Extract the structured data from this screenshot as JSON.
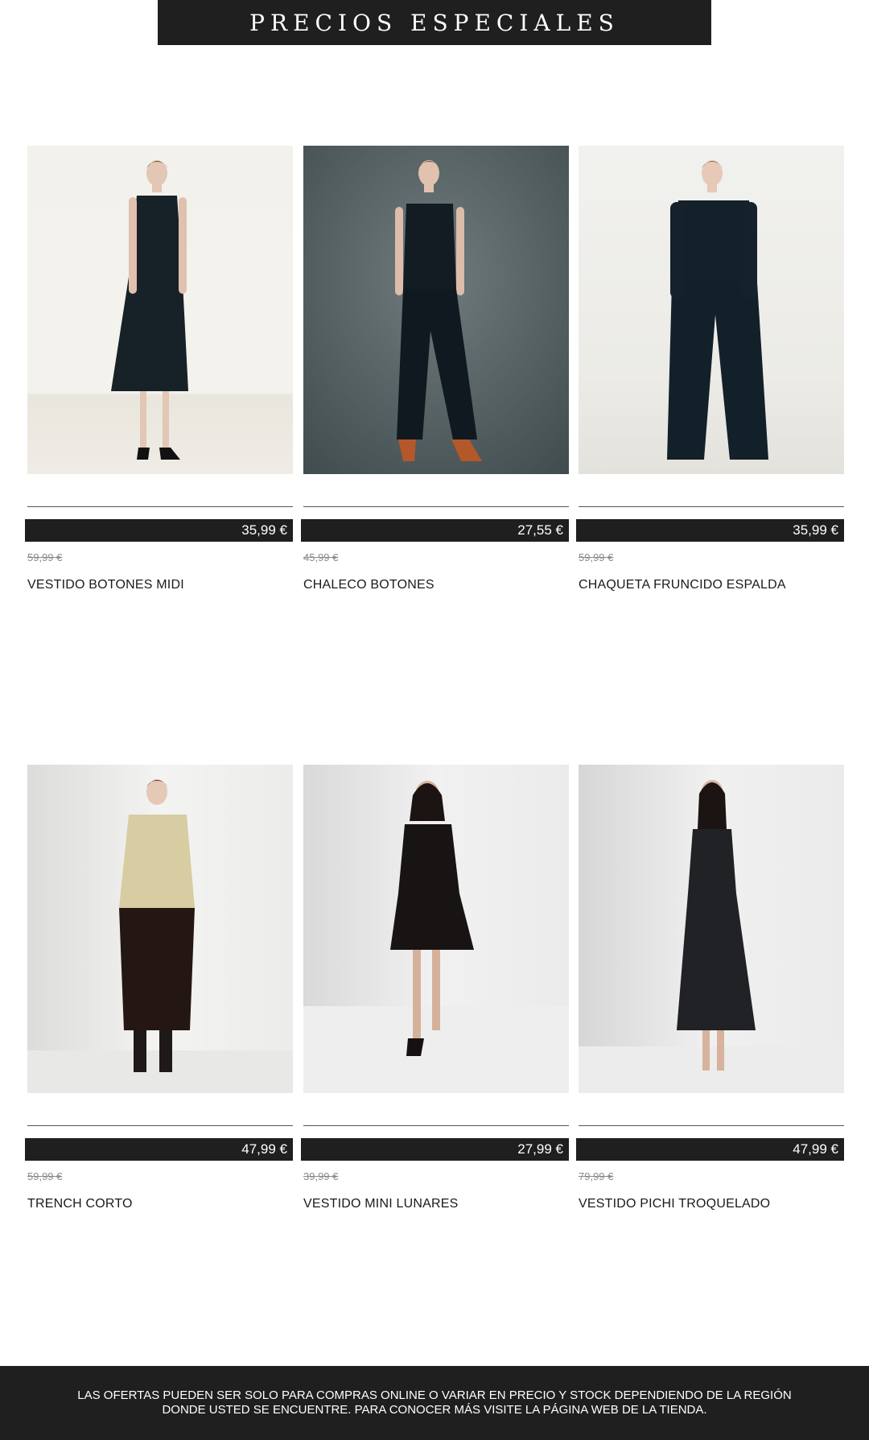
{
  "banner": {
    "title": "PRECIOS ESPECIALES"
  },
  "products": [
    {
      "name": "VESTIDO BOTONES MIDI",
      "price": "35,99 €",
      "old_price": "59,99 €"
    },
    {
      "name": "CHALECO BOTONES",
      "price": "27,55 €",
      "old_price": "45,99 €"
    },
    {
      "name": "CHAQUETA FRUNCIDO ESPALDA",
      "price": "35,99 €",
      "old_price": "59,99 €"
    },
    {
      "name": "TRENCH CORTO",
      "price": "47,99 €",
      "old_price": "59,99 €"
    },
    {
      "name": "VESTIDO MINI LUNARES",
      "price": "27,99 €",
      "old_price": "39,99 €"
    },
    {
      "name": "VESTIDO PICHI TROQUELADO",
      "price": "47,99 €",
      "old_price": "79,99 €"
    }
  ],
  "footer": {
    "line1": "LAS OFERTAS PUEDEN SER SOLO PARA COMPRAS ONLINE O VARIAR EN PRECIO Y STOCK DEPENDIENDO DE LA REGIÓN",
    "line2": "DONDE USTED SE ENCUENTRE. PARA CONOCER MÁS VISITE LA PÁGINA WEB DE LA TIENDA."
  },
  "colors": {
    "banner_bg": "#1f1f1f",
    "price_bar_bg": "#1f1f1f",
    "old_price": "#8a8a8a"
  }
}
